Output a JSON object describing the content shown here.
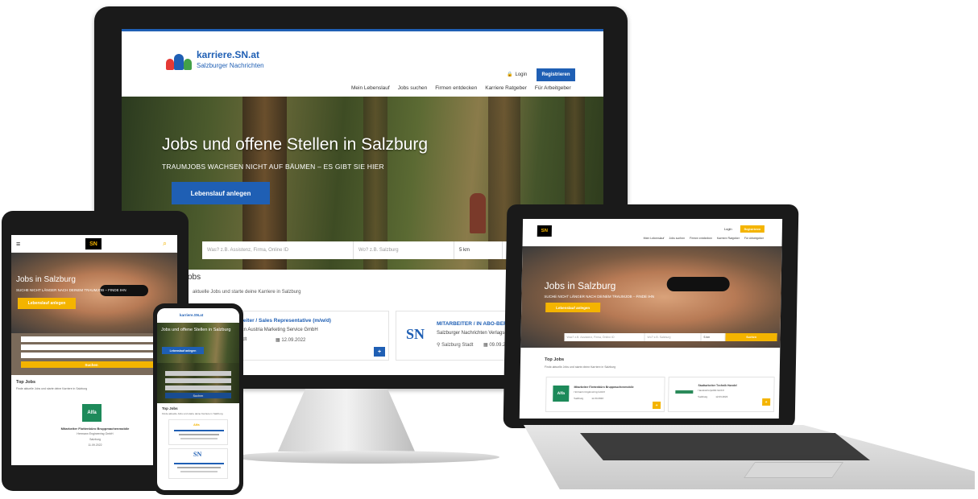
{
  "desktop": {
    "logo_title": "karriere.SN.at",
    "logo_subtitle": "Salzburger Nachrichten",
    "login": "Login",
    "register": "Registrieren",
    "nav": [
      "Mein Lebenslauf",
      "Jobs suchen",
      "Firmen entdecken",
      "Karriere Ratgeber",
      "Für Arbeitgeber"
    ],
    "hero_title": "Jobs und offene Stellen in Salzburg",
    "hero_subtitle": "TRAUMJOBS WACHSEN NICHT AUF BÄUMEN – ES GIBT SIE HIER",
    "cta": "Lebenslauf anlegen",
    "search_placeholder": "Was? z.B. Assistenz, Firma, Online ID",
    "location_placeholder": "Wo? z.B. Salzburg",
    "radius": "5 km",
    "section_title": "obs",
    "section_sub": "aktuelle Jobs und starte deine Karriere in Salzburg",
    "job1_title": "mitarbeiter / Sales Representative (m/w/d)",
    "job1_company": "Prodtecn Austria Marketing Service GmbH",
    "job1_place": "urg Stadt",
    "job1_date": "12.09.2022",
    "job2_logo": "SN",
    "job2_title": "MITARBEITER / IN ABO-BERATUN",
    "job2_company": "Salzburger Nachrichten Verlagsgesell",
    "job2_place": "Salzburg Stadt",
    "job2_date": "09.09.2022"
  },
  "tablet": {
    "logo": "SN",
    "hero_title": "Jobs in Salzburg",
    "hero_sub": "SUCHE NICHT LÄNGER NACH DEINEM TRAUMJOB – FINDE IHN",
    "cta": "Lebenslauf anlegen",
    "search_btn": "Suchen",
    "top_jobs": "Top Jobs",
    "top_sub": "Finde aktuelle Jobs und starte deine Karriere in Salzburg",
    "job_title": "Mitarbeiter Flottenbüro Bruppmachenmobile",
    "job_company": "Hermann Engineering GmbH",
    "job_place": "Salzburg",
    "job_date": "11.09.2022"
  },
  "phone": {
    "logo": "karriere.SN.at",
    "hero_title": "Jobs und offene Stellen in Salzburg",
    "cta": "Lebenslauf anlegen",
    "search_btn": "Suchen",
    "top_jobs": "Top Jobs",
    "top_sub": "Finde aktuelle Jobs und starte deine Karriere in Salzburg",
    "card1_logo": "Alfa",
    "card2_logo": "SN"
  },
  "laptop": {
    "logo": "SN",
    "nav": [
      "Mein Lebenslauf",
      "Jobs suchen",
      "Firmen entdecken",
      "Karriere Ratgeber",
      "Für Arbeitgeber"
    ],
    "login": "Login",
    "register": "Registrieren",
    "hero_title": "Jobs in Salzburg",
    "hero_sub": "SUCHE NICHT LÄNGER NACH DEINEM TRAUMJOB – FINDE IHN",
    "cta": "Lebenslauf anlegen",
    "search_placeholder": "Was? z.B. Assistenz, Firma, Online ID",
    "location_placeholder": "Wo? z.B. Salzburg",
    "radius": "5 km",
    "search_btn": "Suchen",
    "top_jobs": "Top Jobs",
    "top_sub": "Finde aktuelle Jobs und starte deine Karriere in Salzburg",
    "job1_title": "Mitarbeiter Flottenbüro Bruppmachenmobile",
    "job1_company": "Hermann Engineering GmbH",
    "job1_place": "Salzburg",
    "job1_date": "11.09.2022",
    "job2_title": "Stadtarbeiter Technik Handel",
    "job2_company": "Hauskontorpolitik GmbH",
    "job2_place": "Salzburg",
    "job2_date": "12.09.2022"
  }
}
